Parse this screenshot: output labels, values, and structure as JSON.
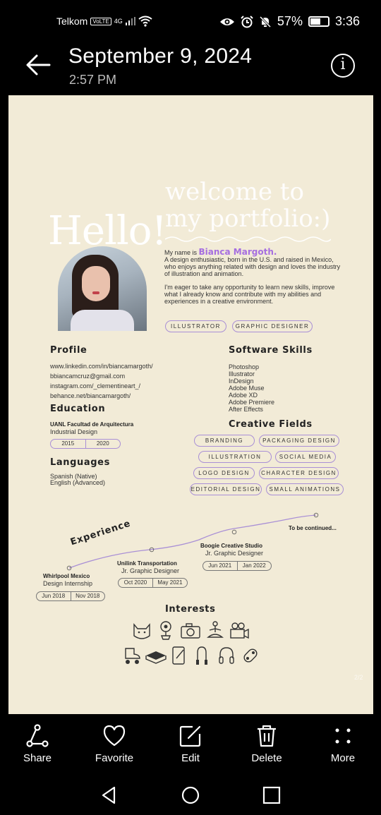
{
  "status_bar": {
    "carrier": "Telkom",
    "volte": "VoLTE",
    "network": "4G",
    "battery": "57%",
    "time": "3:36"
  },
  "header": {
    "date": "September 9, 2024",
    "time": "2:57 PM",
    "info_label": "i"
  },
  "portfolio": {
    "welcome_line1": "welcome to",
    "welcome_line2": "my portfolio:)",
    "hello": "Hello!",
    "intro_prefix": "My name is ",
    "name": "Bianca Margoth.",
    "intro_1": "A design enthusiastic, born in the U.S. and raised in Mexico, who enjoys anything related with design and loves the industry of illustration and animation.",
    "intro_2": "I'm eager to take any opportunity to learn new skills, improve what I already know and contribute with my abilities and experiences in a creative environment.",
    "roles": [
      "ILLUSTRATOR",
      "GRAPHIC DESIGNER"
    ],
    "profile_title": "Profile",
    "profile_links": [
      "www.linkedin.com/in/biancamargoth/",
      "bbiancamcruz@gmail.com",
      "instagram.com/_clementineart_/",
      "behance.net/biancamargoth/"
    ],
    "software_title": "Software Skills",
    "software": [
      "Photoshop",
      "Illustrator",
      "InDesign",
      "Adobe Muse",
      "Adobe XD",
      "Adobe Premiere",
      "After Effects"
    ],
    "education_title": "Education",
    "education_school": "UANL Facultad de Arquitectura",
    "education_degree": "Industrial Design",
    "education_from": "2015",
    "education_to": "2020",
    "languages_title": "Languages",
    "languages": [
      "Spanish (Native)",
      "English (Advanced)"
    ],
    "creative_title": "Creative Fields",
    "creative_fields": [
      "BRANDING",
      "PACKAGING DESIGN",
      "ILLUSTRATION",
      "SOCIAL MEDIA",
      "LOGO DESIGN",
      "CHARACTER DESIGN",
      "EDITORIAL DESIGN",
      "SMALL ANIMATIONS"
    ],
    "experience_title": "Experience",
    "jobs": [
      {
        "company": "Whirlpool Mexico",
        "role": "Design Internship",
        "from": "Jun 2018",
        "to": "Nov 2018"
      },
      {
        "company": "Unilink Transportation",
        "role": "Jr. Graphic Designer",
        "from": "Oct 2020",
        "to": "May 2021"
      },
      {
        "company": "Boogie Creative Studio",
        "role": "Jr. Graphic Designer",
        "from": "Jun 2021",
        "to": "Jan 2022"
      }
    ],
    "continued": "To be continued...",
    "interests_title": "Interests",
    "interest_icons": [
      "cat-icon",
      "plant-icon",
      "camera-icon",
      "meditation-icon",
      "video-camera-icon",
      "rollerskate-icon",
      "book-icon",
      "tablet-icon",
      "jump-rope-icon",
      "headphones-icon",
      "game-controller-icon"
    ],
    "page_marker": "2/2"
  },
  "actions": {
    "share": "Share",
    "favorite": "Favorite",
    "edit": "Edit",
    "delete": "Delete",
    "more": "More"
  }
}
